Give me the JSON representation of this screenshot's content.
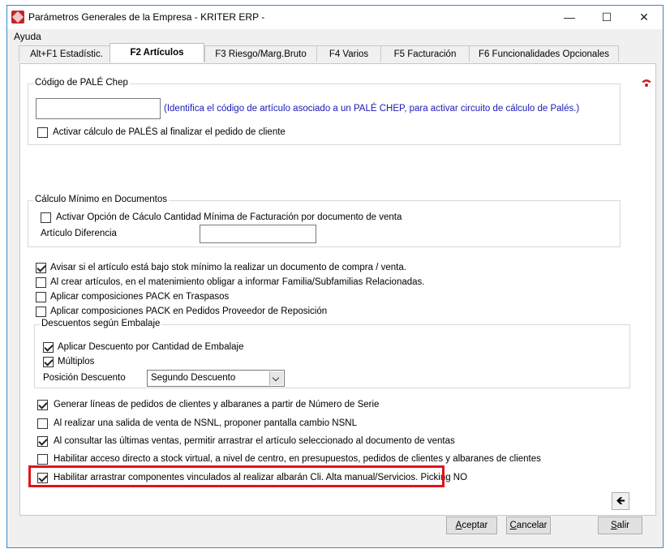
{
  "window": {
    "title": "Parámetros Generales de la Empresa - KRITER ERP -",
    "minimize": "—",
    "maximize": "☐",
    "close": "✕"
  },
  "menu": {
    "help": "Ayuda"
  },
  "tabs": [
    {
      "label": "Alt+F1 Estadístic."
    },
    {
      "label": "F2 Artículos"
    },
    {
      "label": "F3 Riesgo/Marg.Bruto"
    },
    {
      "label": "F4 Varios"
    },
    {
      "label": "F5 Facturación"
    },
    {
      "label": "F6 Funcionalidades Opcionales"
    }
  ],
  "pale": {
    "title": "Código de PALÉ Chep",
    "input_value": "",
    "hint": "(Identifica el código de artículo asociado a un PALÉ CHEP, para activar circuito de cálculo de Palés.)",
    "checkbox_label": "Activar cálculo de PALÉS al finalizar el pedido de cliente",
    "checked": false
  },
  "minimo": {
    "title": "Cálculo Mínimo en Documentos",
    "checkbox_label": "Activar Opción de Cáculo Cantidad Mínima de Facturación por documento de venta",
    "checked": false,
    "field_label": "Artículo Diferencia",
    "field_value": ""
  },
  "options1": [
    {
      "label": "Avisar si el artículo está bajo stok mínimo la realizar un documento de compra / venta.",
      "checked": true
    },
    {
      "label": "Al crear artículos, en el matenimiento obligar a informar Familia/Subfamilias Relacionadas.",
      "checked": false
    },
    {
      "label": "Aplicar composiciones PACK en Traspasos",
      "checked": false
    },
    {
      "label": "Aplicar composiciones PACK en Pedidos Proveedor de Reposición",
      "checked": false
    }
  ],
  "embalaje": {
    "title": "Descuentos según Embalaje",
    "items": [
      {
        "label": "Aplicar Descuento por Cantidad de Embalaje",
        "checked": true
      },
      {
        "label": "Múltiplos",
        "checked": true
      }
    ],
    "position_label": "Posición Descuento",
    "position_value": "Segundo Descuento"
  },
  "options2": [
    {
      "label": "Generar líneas de pedidos de clientes y albaranes a partir de Número de Serie",
      "checked": true
    },
    {
      "label": "Al realizar una salida de venta de NSNL, proponer pantalla cambio  NSNL",
      "checked": false
    },
    {
      "label": "Al consultar las últimas ventas, permitir arrastrar el artículo seleccionado al documento de ventas",
      "checked": true
    },
    {
      "label": "Habilitar acceso directo a stock virtual, a nivel de centro, en presupuestos, pedidos de clientes y albaranes de clientes",
      "checked": false
    },
    {
      "label": "Habilitar arrastrar componentes vinculados al realizar albarán Cli. Alta manual/Servicios. Picking NO",
      "checked": true
    }
  ],
  "buttons": {
    "accept_first": "A",
    "accept_rest": "ceptar",
    "cancel_first": "C",
    "cancel_rest": "ancelar",
    "exit_first": "S",
    "exit_rest": "alir",
    "back": "🡸"
  },
  "colors": {
    "highlight": "#e1141b",
    "hint": "#1a1ab4"
  }
}
